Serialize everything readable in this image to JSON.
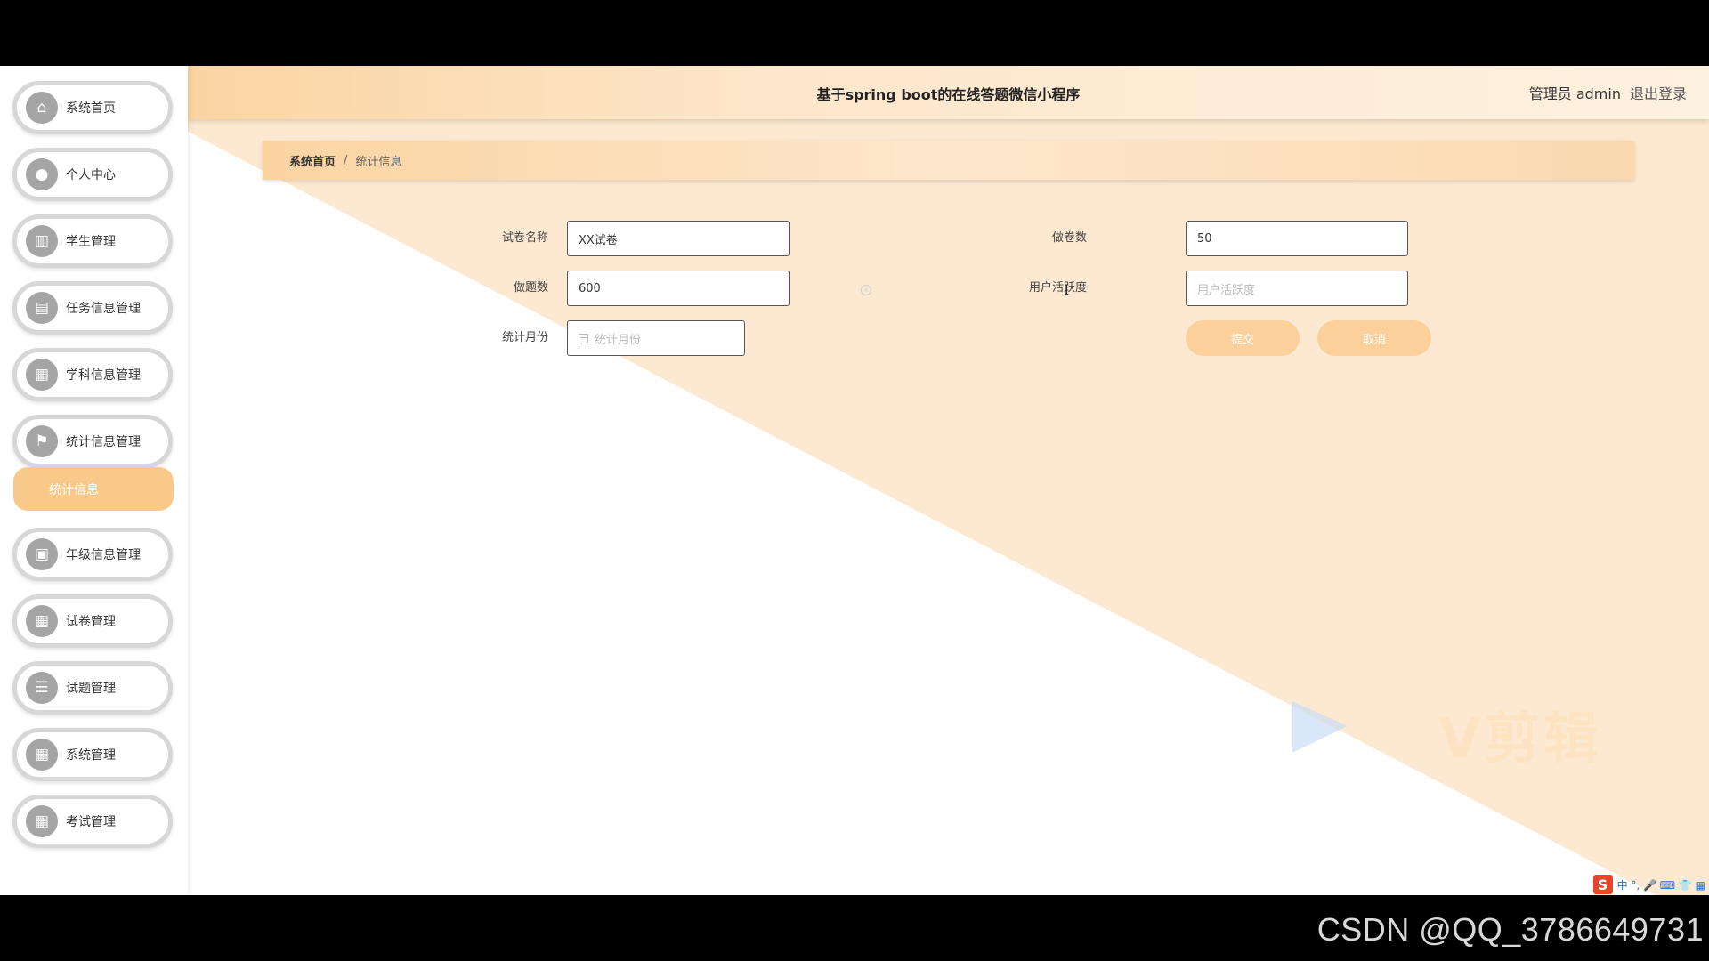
{
  "header": {
    "title": "基于spring boot的在线答题微信小程序",
    "user_role": "管理员 admin",
    "logout": "退出登录"
  },
  "sidebar": {
    "items": [
      {
        "label": "系统首页",
        "icon": "home-icon",
        "glyph": "⌂"
      },
      {
        "label": "个人中心",
        "icon": "user-icon",
        "glyph": "●"
      },
      {
        "label": "学生管理",
        "icon": "book-icon",
        "glyph": "▥"
      },
      {
        "label": "任务信息管理",
        "icon": "chat-icon",
        "glyph": "▤"
      },
      {
        "label": "学科信息管理",
        "icon": "grid-icon",
        "glyph": "▦"
      },
      {
        "label": "统计信息管理",
        "icon": "flag-icon",
        "glyph": "⚑"
      },
      {
        "label": "年级信息管理",
        "icon": "clipboard-icon",
        "glyph": "▣"
      },
      {
        "label": "试卷管理",
        "icon": "grid-icon",
        "glyph": "▦"
      },
      {
        "label": "试题管理",
        "icon": "list-icon",
        "glyph": "☰"
      },
      {
        "label": "系统管理",
        "icon": "grid-icon",
        "glyph": "▦"
      },
      {
        "label": "考试管理",
        "icon": "table-icon",
        "glyph": "▦"
      }
    ],
    "active_sub": "统计信息"
  },
  "breadcrumb": {
    "home": "系统首页",
    "separator": "/",
    "current": "统计信息"
  },
  "form": {
    "paper_name_label": "试卷名称",
    "paper_name_value": "XX试卷",
    "paper_count_label": "做卷数",
    "paper_count_value": "50",
    "question_count_label": "做题数",
    "question_count_value": "600",
    "activity_label": "用户活跃度",
    "activity_placeholder": "用户活跃度",
    "month_label": "统计月份",
    "month_placeholder": "统计月份",
    "submit": "提交",
    "cancel": "取消"
  },
  "overlay": {
    "csdn_watermark": "CSDN @QQ_3786649731",
    "editor_watermark": "V剪辑",
    "ime_status": "中 °, 🎤 ⌨ 👕 ▦"
  },
  "colors": {
    "accent": "#fbd09b",
    "header_bg": "#fde7cc",
    "diagonal_bg": "#fde9d1"
  }
}
